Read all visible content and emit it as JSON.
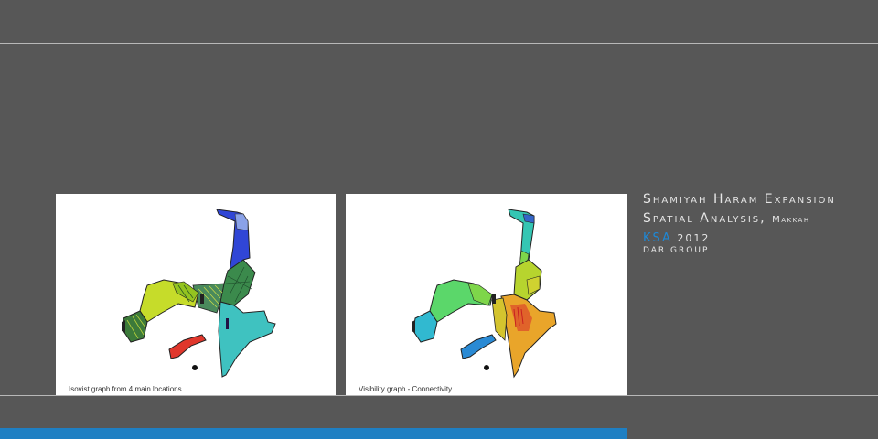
{
  "slide": {
    "title_line1": "Shamiyah Haram Expansion",
    "title_line2": "Spatial Analysis,",
    "title_line2_small": "Makkah",
    "country": "KSA",
    "year": "2012",
    "firm": "DAR GROUP"
  },
  "panels": [
    {
      "caption": "Isovist graph from 4 main locations"
    },
    {
      "caption": "Visibility graph - Connectivity"
    }
  ],
  "colors": {
    "background": "#575757",
    "accent": "#1e7fc3",
    "ksa_text": "#1e88d6",
    "rule": "#b8b8b8"
  }
}
